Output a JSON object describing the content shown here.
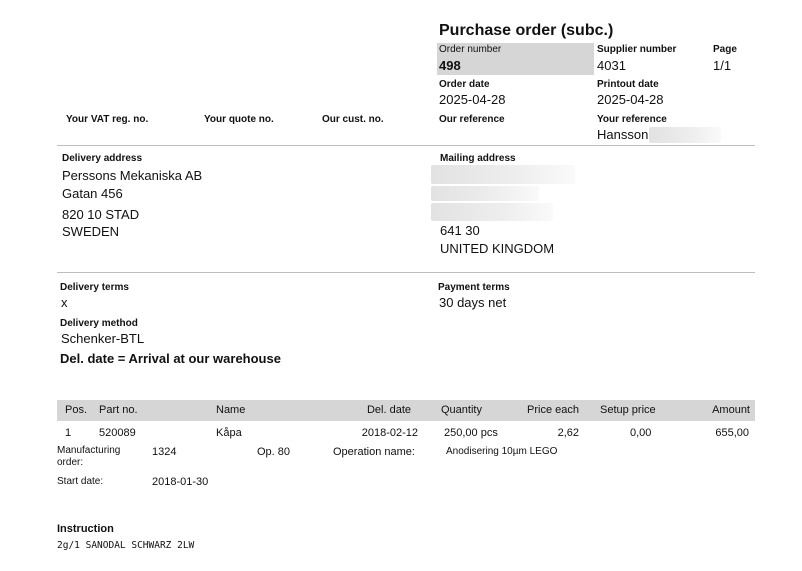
{
  "header": {
    "title": "Purchase order (subc.)",
    "order_number_label": "Order number",
    "order_number": "498",
    "supplier_number_label": "Supplier number",
    "supplier_number": "4031",
    "page_label": "Page",
    "page": "1/1",
    "order_date_label": "Order date",
    "order_date": "2025-04-28",
    "printout_date_label": "Printout date",
    "printout_date": "2025-04-28",
    "vat_label": "Your VAT reg. no.",
    "quote_label": "Your quote no.",
    "cust_label": "Our cust. no.",
    "our_ref_label": "Our reference",
    "your_ref_label": "Your reference",
    "your_ref": "Hansson"
  },
  "delivery_address": {
    "label": "Delivery address",
    "line1": "Perssons Mekaniska AB",
    "line2": "Gatan 456",
    "line3": "820 10 STAD",
    "line4": "SWEDEN"
  },
  "mailing_address": {
    "label": "Mailing address",
    "postcode": "641 30",
    "country": "UNITED KINGDOM"
  },
  "terms": {
    "delivery_terms_label": "Delivery terms",
    "delivery_terms": "x",
    "payment_terms_label": "Payment terms",
    "payment_terms": "30 days net",
    "delivery_method_label": "Delivery method",
    "delivery_method": "Schenker-BTL",
    "del_date_note": "Del. date = Arrival at our warehouse"
  },
  "table": {
    "columns": [
      "Pos.",
      "Part no.",
      "Name",
      "Del. date",
      "Quantity",
      "Price each",
      "Setup price",
      "Amount"
    ],
    "rows": [
      {
        "pos": "1",
        "part_no": "520089",
        "name": "Kåpa",
        "del_date": "2018-02-12",
        "quantity": "250,00 pcs",
        "price_each": "2,62",
        "setup_price": "0,00",
        "amount": "655,00",
        "mfg_order_label_1": "Manufacturing",
        "mfg_order_label_2": "order:",
        "mfg_order": "1324",
        "op": "Op. 80",
        "operation_name_label": "Operation name:",
        "operation_name": "Anodisering 10µm LEGO",
        "start_date_label": "Start date:",
        "start_date": "2018-01-30"
      }
    ]
  },
  "instruction": {
    "label": "Instruction",
    "text": "2g/1 SANODAL SCHWARZ 2LW"
  }
}
